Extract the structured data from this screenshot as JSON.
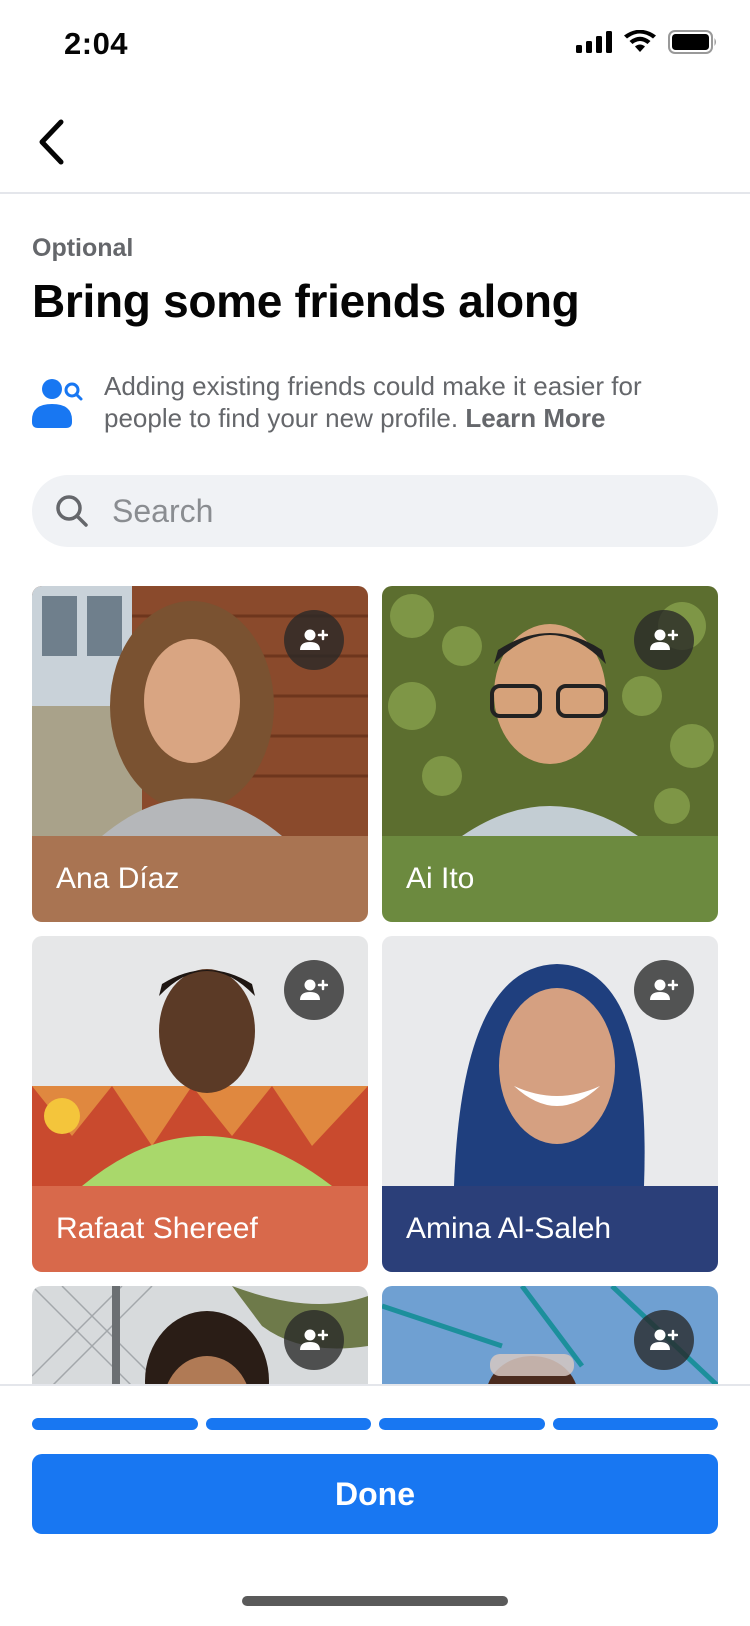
{
  "status_bar": {
    "time": "2:04"
  },
  "header": {
    "eyebrow": "Optional",
    "title": "Bring some friends along",
    "info_text": "Adding existing friends could make it easier for people to find your new profile.",
    "learn_more": "Learn More"
  },
  "search": {
    "placeholder": "Search",
    "value": ""
  },
  "friends": [
    {
      "name": "Ana Díaz",
      "band_color": "#a97452"
    },
    {
      "name": "Ai Ito",
      "band_color": "#6c8a3f"
    },
    {
      "name": "Rafaat Shereef",
      "band_color": "#d8694b"
    },
    {
      "name": "Amina Al-Saleh",
      "band_color": "#2b3f79"
    },
    {
      "name": "",
      "band_color": "#6b6b6b"
    },
    {
      "name": "",
      "band_color": "#4a7fb5"
    }
  ],
  "progress": {
    "total_steps": 4,
    "completed_steps": 4
  },
  "footer": {
    "done_label": "Done"
  },
  "colors": {
    "accent": "#1877f2",
    "secondary_text": "#65676b",
    "search_bg": "#f0f2f5"
  },
  "icons": [
    "back-chevron-icon",
    "signal-icon",
    "wifi-icon",
    "battery-icon",
    "people-search-icon",
    "search-icon",
    "add-friend-icon"
  ]
}
